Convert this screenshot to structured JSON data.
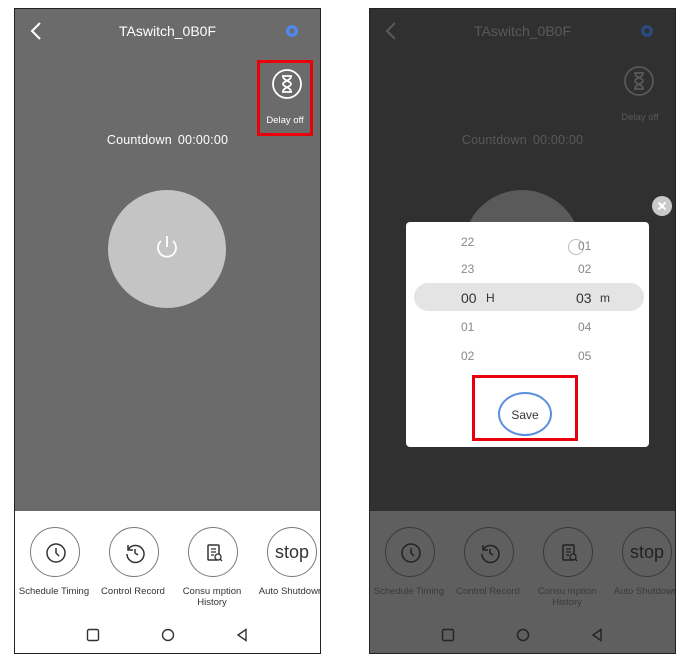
{
  "device_title": "TAswitch_0B0F",
  "delay": {
    "label": "Delay off"
  },
  "countdown": {
    "label": "Countdown",
    "value": "00:00:00"
  },
  "functions": [
    {
      "label": "Schedule Timing",
      "icon": "clock-icon"
    },
    {
      "label": "Control Record",
      "icon": "history-icon"
    },
    {
      "label": "Consu mption History",
      "icon": "receipt-icon"
    },
    {
      "label": "Auto Shutdown",
      "text": "stop"
    }
  ],
  "picker": {
    "hours": [
      "22",
      "23",
      "00",
      "01",
      "02"
    ],
    "minutes": [
      "01",
      "02",
      "03",
      "04",
      "05"
    ],
    "hour_unit": "H",
    "minute_unit": "m",
    "save_label": "Save"
  },
  "colors": {
    "highlight": "#e8000b",
    "screen_normal": "#6b6b6b",
    "screen_dimmed": "#303030",
    "accent_blue": "#5b8fe0"
  }
}
